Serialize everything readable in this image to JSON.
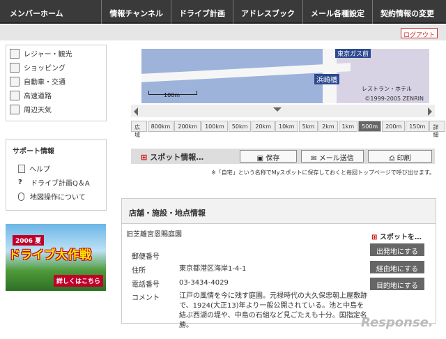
{
  "nav": {
    "home": "メンバーホーム",
    "menu": [
      "情報チャンネル",
      "ドライブ計画",
      "アドレスブック",
      "メール各種設定",
      "契約情報の変更"
    ],
    "logout": "ログアウト"
  },
  "categories": [
    "レジャー・観光",
    "ショッピング",
    "自動車・交通",
    "高速道路",
    "周辺天気"
  ],
  "support": {
    "heading": "サポート情報",
    "items": [
      "ヘルプ",
      "ドライブ計画Q＆A",
      "地図操作について"
    ]
  },
  "banner": {
    "year": "2006 夏",
    "title": "ドライブ大作戦",
    "cta": "詳しくはこちら"
  },
  "map": {
    "label1": "東京ガス前",
    "label2": "浜崎橋",
    "label3": "レストラン・ホテル",
    "scale": "100m",
    "copyright": "©1999-2005 ZENRIN",
    "zoom_levels": [
      "広域",
      "800km",
      "200km",
      "100km",
      "50km",
      "20km",
      "10km",
      "5km",
      "2km",
      "1km",
      "500m",
      "200m",
      "150m",
      "詳細"
    ],
    "active_zoom": "500m"
  },
  "spotbar": {
    "title": "スポット情報…",
    "save": "保存",
    "mail": "メール送信",
    "print": "印刷",
    "note": "※「自宅」という名称でMyスポットに保存しておくと毎回トップページで呼び出せます。"
  },
  "shop": {
    "heading": "店舗・施設・地点情報",
    "name": "旧芝離宮恩賜庭園",
    "spot_options": "スポットを…",
    "buttons": [
      "出発地にする",
      "経由地にする",
      "目的地にする"
    ],
    "fields": [
      {
        "key": "郵便番号",
        "value": ""
      },
      {
        "key": "住所",
        "value": "東京都港区海岸1-4-1"
      },
      {
        "key": "電話番号",
        "value": "03-3434-4029"
      },
      {
        "key": "コメント",
        "value": "江戸の風情を今に残す庭園。元禄時代の大久保忠朝上屋敷跡で、1924(大正13)年より一般公開されている。池と中島を結ぶ西湖の堤や、中島の石組など見ごたえも十分。国指定名勝。"
      }
    ]
  },
  "watermark": "Response."
}
